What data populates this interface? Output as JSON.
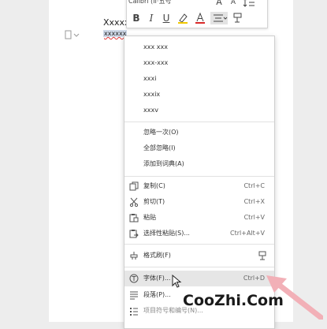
{
  "document": {
    "line1": "Xxxxx",
    "line2": "xxxxxx"
  },
  "minibar": {
    "font": "Calibri (II·五号",
    "size": "五号",
    "buttons": [
      "B",
      "I",
      "U"
    ],
    "grow": "A",
    "shrink": "A"
  },
  "menu": {
    "suggestions": [
      "xxx xxx",
      "xxx-xxx",
      "xxxi",
      "xxxix",
      "xxxv"
    ],
    "spell": [
      {
        "label": "忽略一次(O)"
      },
      {
        "label": "全部忽略(I)"
      },
      {
        "label": "添加到词典(A)"
      }
    ],
    "clipboard": [
      {
        "label": "复制(C)",
        "shortcut": "Ctrl+C",
        "icon": "copy-icon"
      },
      {
        "label": "剪切(T)",
        "shortcut": "Ctrl+X",
        "icon": "scissors-icon"
      },
      {
        "label": "粘贴",
        "shortcut": "Ctrl+V",
        "icon": "paste-icon"
      },
      {
        "label": "选择性粘贴(S)...",
        "shortcut": "Ctrl+Alt+V",
        "icon": "paste-special-icon"
      }
    ],
    "format_painter": {
      "label": "格式刷(F)",
      "icon": "brush-icon"
    },
    "font": {
      "label": "字体(F)...",
      "shortcut": "Ctrl+D",
      "icon": "font-icon"
    },
    "paragraph": {
      "label": "段落(P)...",
      "icon": "paragraph-icon"
    },
    "bullets": {
      "label": "项目符号和编号(N)...",
      "icon": "list-icon"
    }
  },
  "watermark": "CooZhi.Com"
}
